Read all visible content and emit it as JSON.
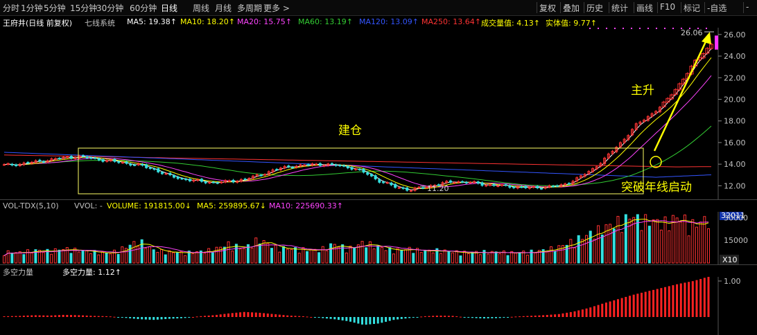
{
  "toolbar": {
    "periods": [
      "分时",
      "1分钟",
      "5分钟",
      "15分钟",
      "30分钟",
      "60分钟",
      "日线",
      "周线",
      "月线",
      "多周期",
      "更多 >"
    ],
    "active_period": "日线",
    "right": [
      "复权",
      "叠加",
      "历史",
      "统计",
      "画线",
      "F10",
      "标记",
      "-自选",
      "-"
    ]
  },
  "main_info": {
    "stock": "王府井(日线 前复权)",
    "system": "七线系统",
    "ma5": "MA5: 19.38↑",
    "ma10": "MA10: 18.20↑",
    "ma20": "MA20: 15.75↑",
    "ma60": "MA60: 13.19↑",
    "ma120": "MA120: 13.09↑",
    "ma250": "MA250: 13.64↑",
    "volume_ma": "成交量值: 4.13↑",
    "body_val": "实体值: 9.77↑"
  },
  "vol_info": {
    "name": "VOL-TDX(5,10)",
    "vvol": "VVOL: -",
    "volume": "VOLUME: 191815.00↓",
    "ma5": "MA5: 259895.67↓",
    "ma10": "MA10: 225690.33↑"
  },
  "power_info": {
    "name": "多空力量",
    "value": "多空力量: 1.12↑"
  },
  "annotations": {
    "jiancang": "建仓",
    "zhusheng": "主升",
    "tupo": "突破年线启动",
    "low_label": "11.20",
    "high_label": "26.06"
  },
  "price_axis": [
    "26.00",
    "24.00",
    "22.00",
    "20.00",
    "18.00",
    "16.00",
    "14.00",
    "12.00"
  ],
  "vol_axis": [
    "32011",
    "30000",
    "15000",
    "X10"
  ],
  "power_axis": [
    "1.00"
  ],
  "colors": {
    "up": "#ff3333",
    "down": "#33e0e0",
    "ma5": "#ffffff",
    "ma10": "#ffff00",
    "ma20": "#ff44ff",
    "ma60": "#33cc33",
    "ma120": "#3355ff",
    "ma250": "#ff3333",
    "annotation": "#ffff00"
  },
  "chart_data": [
    {
      "type": "candlestick",
      "title": "王府井(日线 前复权)",
      "ylim": [
        11.0,
        26.5
      ],
      "y_ticks": [
        12,
        14,
        16,
        18,
        20,
        22,
        24,
        26
      ],
      "segments": [
        {
          "phase": "early plateau",
          "price_range": [
            13.6,
            14.8
          ]
        },
        {
          "phase": "decline",
          "price_range": [
            12.2,
            14.6
          ]
        },
        {
          "phase": "rebound",
          "price_range": [
            12.4,
            14.1
          ]
        },
        {
          "phase": "consolidation low",
          "price_range": [
            11.2,
            13.0
          ]
        },
        {
          "phase": "breakout",
          "price_range": [
            12.5,
            26.06
          ]
        }
      ],
      "close_approx": [
        13.9,
        14.0,
        14.2,
        14.4,
        14.6,
        14.7,
        14.5,
        14.3,
        14.1,
        13.9,
        13.5,
        12.9,
        12.6,
        12.4,
        12.3,
        12.4,
        12.6,
        13.0,
        13.5,
        13.8,
        13.9,
        14.0,
        13.9,
        13.7,
        13.2,
        12.4,
        11.9,
        11.6,
        11.9,
        12.2,
        12.4,
        12.3,
        12.1,
        12.0,
        11.9,
        11.8,
        11.9,
        12.0,
        12.6,
        13.4,
        14.6,
        16.0,
        17.6,
        18.6,
        19.8,
        21.6,
        23.6,
        25.1
      ],
      "series": [
        {
          "name": "MA5",
          "last": 19.38
        },
        {
          "name": "MA10",
          "last": 18.2
        },
        {
          "name": "MA20",
          "last": 15.75
        },
        {
          "name": "MA60",
          "last": 13.19
        },
        {
          "name": "MA120",
          "last": 13.09
        },
        {
          "name": "MA250",
          "last": 13.64
        }
      ],
      "annotations": [
        "建仓",
        "主升",
        "突破年线启动",
        "11.20",
        "26.06"
      ]
    },
    {
      "type": "bar",
      "title": "VOL-TDX(5,10)",
      "ylim": [
        0,
        32011
      ],
      "y_ticks": [
        15000,
        30000
      ],
      "values_approx": [
        7000,
        6500,
        8000,
        7500,
        9000,
        8000,
        7000,
        6000,
        9500,
        14000,
        8000,
        7000,
        6500,
        7000,
        8500,
        12000,
        9000,
        15000,
        10000,
        9000,
        8500,
        8000,
        12000,
        9000,
        13000,
        10000,
        8000,
        9000,
        7500,
        8000,
        7000,
        6500,
        7000,
        6800,
        6500,
        7000,
        8000,
        10000,
        14000,
        18000,
        22000,
        26000,
        30000,
        27000,
        25000,
        29000,
        24000,
        28000
      ],
      "series": [
        {
          "name": "MA5"
        },
        {
          "name": "MA10"
        }
      ]
    },
    {
      "type": "bar",
      "title": "多空力量",
      "y_ticks": [
        1.0
      ],
      "values_approx": [
        0.02,
        0.03,
        0.05,
        0.04,
        0.06,
        0.05,
        0.03,
        0.02,
        -0.02,
        -0.06,
        -0.08,
        -0.05,
        -0.03,
        0.02,
        0.05,
        0.1,
        0.14,
        0.12,
        0.08,
        0.04,
        0.02,
        -0.02,
        -0.06,
        -0.12,
        -0.22,
        -0.18,
        -0.08,
        -0.03,
        0.02,
        0.04,
        0.03,
        -0.02,
        -0.04,
        -0.03,
        0.01,
        0.03,
        0.05,
        0.08,
        0.15,
        0.25,
        0.38,
        0.5,
        0.62,
        0.72,
        0.82,
        0.92,
        1.0,
        1.12
      ],
      "last": 1.12
    }
  ]
}
